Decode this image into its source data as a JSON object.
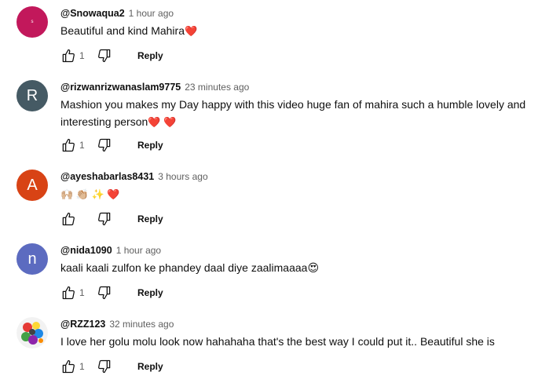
{
  "comments": [
    {
      "author": "@Snowaqua2",
      "time": "1 hour ago",
      "text": "Beautiful and kind Mahira",
      "emoji": "❤️",
      "likes": "1",
      "reply_label": "Reply",
      "avatar": {
        "letter": "s",
        "color": "#c2185b"
      }
    },
    {
      "author": "@rizwanrizwanaslam9775",
      "time": "23 minutes ago",
      "text_line1": "Mashion you makes my Day happy with this video huge fan of mahira such a humble lovely and",
      "text_line2": "interesting person",
      "emoji": "❤️ ❤️",
      "likes": "1",
      "reply_label": "Reply",
      "avatar": {
        "letter": "R",
        "color": "#455a64"
      }
    },
    {
      "author": "@ayeshabarlas8431",
      "time": "3 hours ago",
      "emoji": "🙌🏼 👏🏼 ✨ ❤️",
      "likes": "",
      "reply_label": "Reply",
      "avatar": {
        "letter": "A",
        "color": "#d84315"
      }
    },
    {
      "author": "@nida1090",
      "time": "1 hour ago",
      "text": "kaali kaali zulfon ke phandey daal diye zaalimaaaa",
      "emoji": "😍",
      "likes": "1",
      "reply_label": "Reply",
      "avatar": {
        "letter": "n",
        "color": "#5c6bc0"
      }
    },
    {
      "author": "@RZZ123",
      "time": "32 minutes ago",
      "text": "I love her golu molu look now hahahaha that's the best way I could put it.. Beautiful she is",
      "likes": "1",
      "reply_label": "Reply",
      "avatar": {
        "letter": "",
        "color": "#7b7b7b"
      }
    }
  ],
  "icons": {
    "like": "thumb-up-outline",
    "dislike": "thumb-down-outline"
  },
  "colors": {
    "text": "#0f0f0f",
    "secondary": "#606060",
    "heart": "#e0245e"
  }
}
